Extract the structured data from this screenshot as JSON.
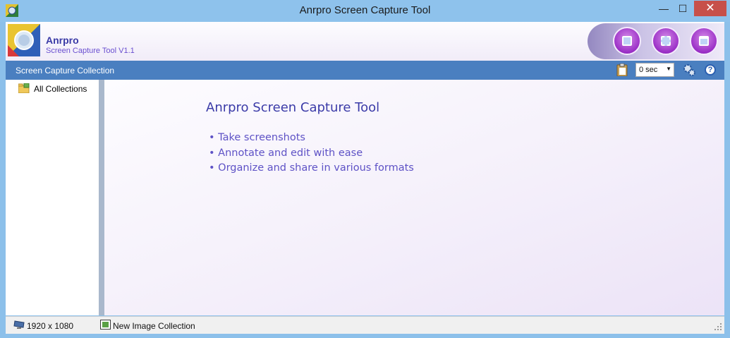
{
  "window": {
    "title": "Anrpro Screen Capture Tool"
  },
  "window_controls": {
    "minimize": "—",
    "maximize": "☐",
    "close": "✕"
  },
  "header": {
    "brand": "Anrpro",
    "subtitle": "Screen Capture Tool V1.1",
    "capture_buttons": [
      "capture-fullscreen",
      "capture-region",
      "capture-window"
    ]
  },
  "toolbar": {
    "collection_label": "Screen Capture Collection",
    "delay_value": "0 sec",
    "help_glyph": "?"
  },
  "sidebar": {
    "items": [
      {
        "label": "All Collections",
        "icon": "folder-icon"
      }
    ]
  },
  "main": {
    "title": "Anrpro Screen Capture Tool",
    "bullets": [
      "• Take screenshots",
      "• Annotate and edit with ease",
      "• Organize and share in various formats"
    ]
  },
  "statusbar": {
    "resolution": "1920 x 1080",
    "new_collection": "New Image Collection"
  },
  "colors": {
    "titlebar": "#8ec2ec",
    "toolbar": "#4a7fc0",
    "close": "#c7504a",
    "brand": "#3a3aa6",
    "accent": "#9a2fc6"
  }
}
